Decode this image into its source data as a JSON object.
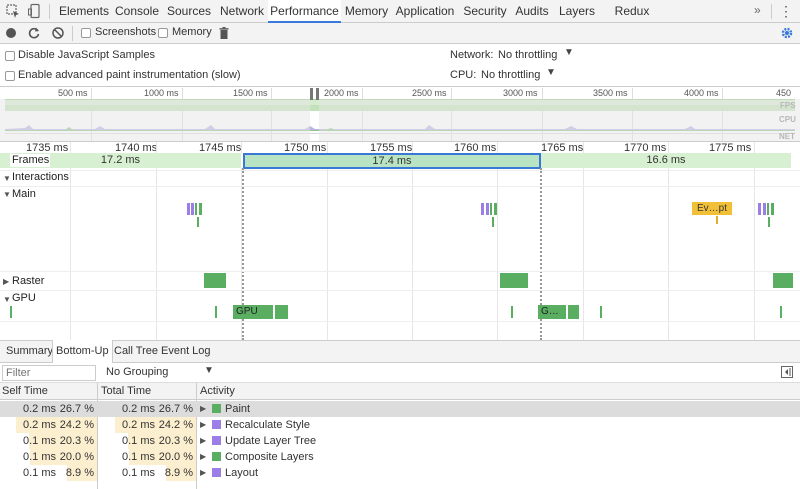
{
  "tabs": [
    "Elements",
    "Console",
    "Sources",
    "Network",
    "Performance",
    "Memory",
    "Application",
    "Security",
    "Audits",
    "Layers",
    "Redux"
  ],
  "active_tab": "Performance",
  "toolbar": {
    "screenshots_label": "Screenshots",
    "memory_label": "Memory"
  },
  "settings": {
    "disable_js_samples": "Disable JavaScript Samples",
    "advanced_paint": "Enable advanced paint instrumentation (slow)",
    "network_label": "Network:",
    "network_value": "No throttling",
    "cpu_label": "CPU:",
    "cpu_value": "No throttling"
  },
  "overview": {
    "ticks": [
      "500 ms",
      "1000 ms",
      "1500 ms",
      "2000 ms",
      "2500 ms",
      "3000 ms",
      "3500 ms",
      "4000 ms",
      "450"
    ],
    "lanes": [
      "FPS",
      "CPU",
      "NET"
    ]
  },
  "timeline": {
    "ticks": [
      "1735 ms",
      "1740 ms",
      "1745 ms",
      "1750 ms",
      "1755 ms",
      "1760 ms",
      "1765 ms",
      "1770 ms",
      "1775 ms"
    ],
    "frames_label": "Frames",
    "frame_durations": [
      "17.2 ms",
      "17.4 ms",
      "16.6 ms"
    ],
    "tracks": [
      "Interactions",
      "Main",
      "Raster",
      "GPU"
    ],
    "event_label": "Ev…pt",
    "gpu_labels": [
      "GPU",
      "G…"
    ]
  },
  "bottom": {
    "tabs": [
      "Summary",
      "Bottom-Up",
      "Call Tree",
      "Event Log"
    ],
    "active_tab": "Bottom-Up",
    "filter_placeholder": "Filter",
    "grouping": "No Grouping",
    "columns": [
      "Self Time",
      "Total Time",
      "Activity"
    ],
    "rows": [
      {
        "self": "0.2 ms",
        "self_pct": "26.7 %",
        "total": "0.2 ms",
        "total_pct": "26.7 %",
        "activity": "Paint",
        "color": "#5aae61"
      },
      {
        "self": "0.2 ms",
        "self_pct": "24.2 %",
        "total": "0.2 ms",
        "total_pct": "24.2 %",
        "activity": "Recalculate Style",
        "color": "#9b7fe6"
      },
      {
        "self": "0.1 ms",
        "self_pct": "20.3 %",
        "total": "0.1 ms",
        "total_pct": "20.3 %",
        "activity": "Update Layer Tree",
        "color": "#9b7fe6"
      },
      {
        "self": "0.1 ms",
        "self_pct": "20.0 %",
        "total": "0.1 ms",
        "total_pct": "20.0 %",
        "activity": "Composite Layers",
        "color": "#5aae61"
      },
      {
        "self": "0.1 ms",
        "self_pct": "8.9 %",
        "total": "0.1 ms",
        "total_pct": "8.9 %",
        "activity": "Layout",
        "color": "#9b7fe6"
      }
    ]
  },
  "colors": {
    "accent": "#3879d9",
    "frame_green": "#d7f0d1",
    "rendering_purple": "#9b7fe6",
    "painting_green": "#5aae61",
    "scripting_yellow": "#f2c037"
  }
}
